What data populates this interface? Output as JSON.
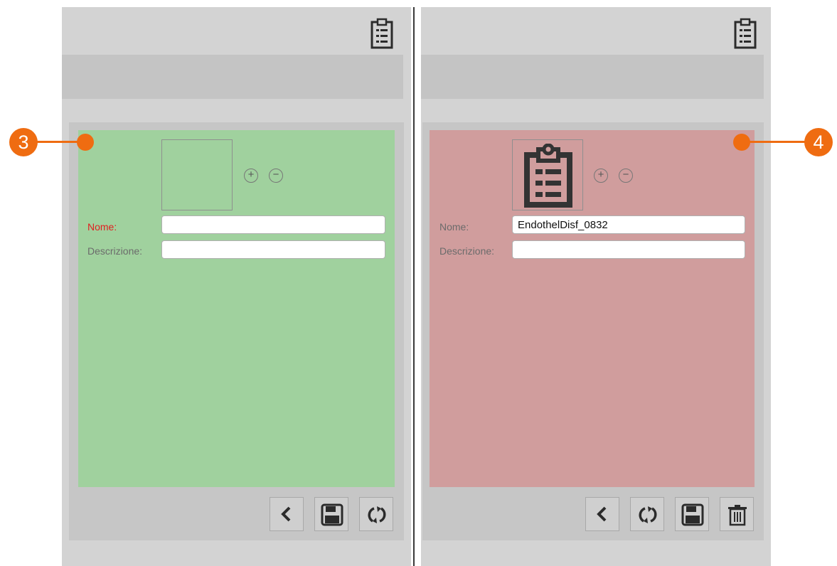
{
  "colors": {
    "new_card": "#a0d19e",
    "edit_card": "#d09d9d",
    "callout": "#ef6c11",
    "required_label": "#e02020"
  },
  "left_panel": {
    "header_icon": "clipboard-list-icon",
    "form": {
      "name_label": "Nome:",
      "name_value": "",
      "description_label": "Descrizione:",
      "description_value": ""
    },
    "actions": [
      "back-icon",
      "save-icon",
      "refresh-icon"
    ]
  },
  "right_panel": {
    "header_icon": "clipboard-list-icon",
    "form": {
      "name_label": "Nome:",
      "name_value": "EndothelDisf_0832",
      "description_label": "Descrizione:",
      "description_value": ""
    },
    "actions": [
      "back-icon",
      "refresh-icon",
      "save-icon",
      "trash-icon"
    ]
  },
  "callouts": {
    "left": "3",
    "right": "4"
  }
}
